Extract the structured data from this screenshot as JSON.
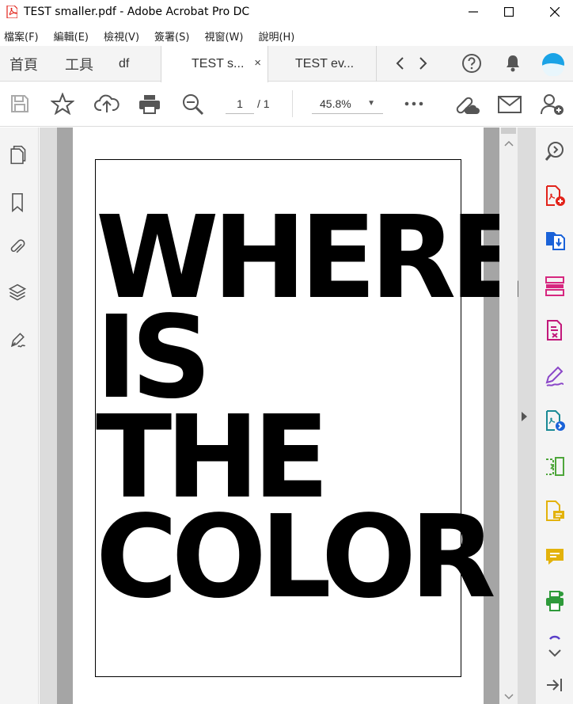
{
  "window": {
    "title": "TEST smaller.pdf - Adobe Acrobat Pro DC",
    "minimize_glyph": "—",
    "maximize_glyph": "☐",
    "close_glyph": "✕"
  },
  "menu": [
    "檔案(F)",
    "編輯(E)",
    "檢視(V)",
    "簽署(S)",
    "視窗(W)",
    "說明(H)"
  ],
  "tabs": {
    "home_label": "首頁",
    "tools_label": "工具",
    "partial_tab_label": "df",
    "active_tab_label": "TEST s...",
    "inactive_tab_label": "TEST ev...",
    "close_glyph": "×"
  },
  "toolbar": {
    "page_current": "1",
    "page_total": "/ 1",
    "zoom": "45.8%"
  },
  "document": {
    "lines": [
      "WHERE",
      "IS",
      "THE",
      "COLOR"
    ]
  },
  "colors": {
    "acrobat_red": "#e2231a",
    "export_blue": "#1a62d8",
    "organize_pink": "#d6277f",
    "compress_pink": "#c2187a",
    "fill_sign_purple": "#8a46c8",
    "send_teal": "#1a8a95",
    "compare_green": "#4ea63b",
    "comment_yellow": "#e3b20b",
    "print_green": "#2e9a3a",
    "avatar_blue": "#1aa3e6"
  }
}
